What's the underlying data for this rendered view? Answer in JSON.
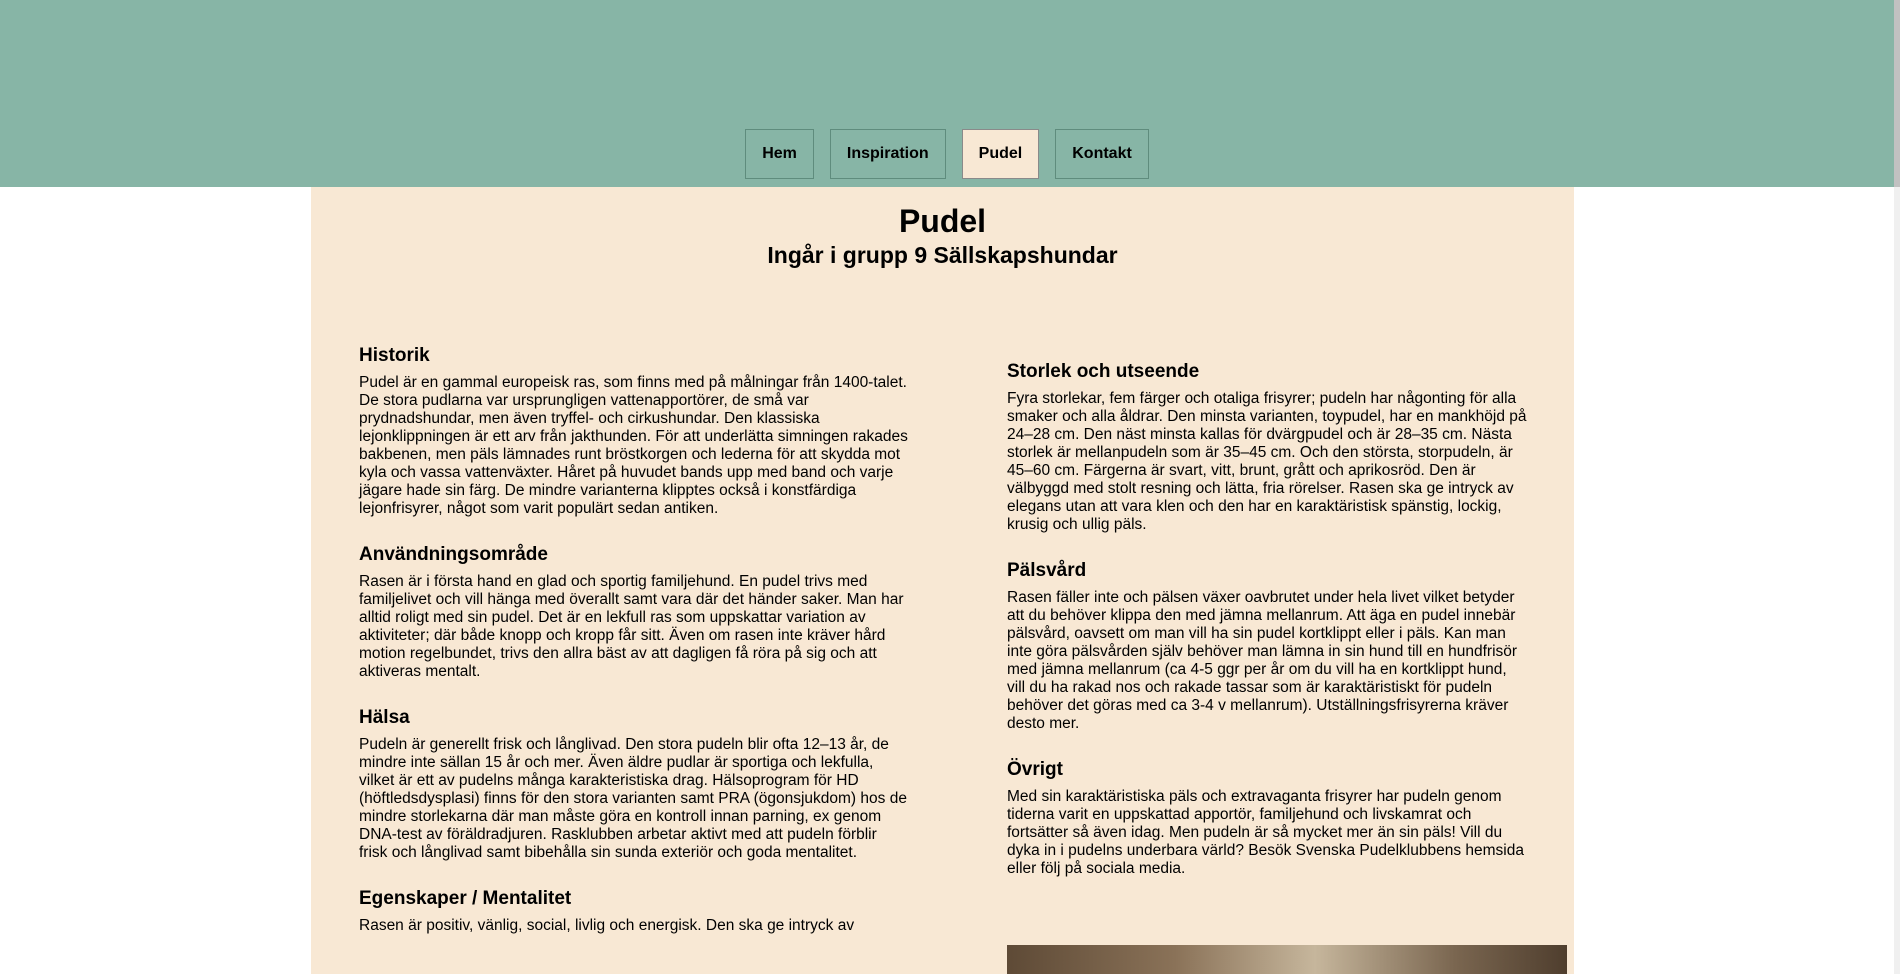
{
  "nav": {
    "items": [
      {
        "label": "Hem",
        "active": false
      },
      {
        "label": "Inspiration",
        "active": false
      },
      {
        "label": "Pudel",
        "active": true
      },
      {
        "label": "Kontakt",
        "active": false
      }
    ]
  },
  "page": {
    "title": "Pudel",
    "subtitle": "Ingår i grupp 9 Sällskapshundar"
  },
  "left_sections": [
    {
      "heading": "Historik",
      "text": "Pudel är en gammal europeisk ras, som finns med på målningar från 1400-talet. De stora pudlarna var ursprungligen vattenapportörer, de små var prydnadshundar, men även tryffel- och cirkushundar. Den klassiska lejonklippningen är ett arv från jakthunden. För att underlätta simningen rakades bakbenen, men päls lämnades runt bröstkorgen och lederna för att skydda mot kyla och vassa vattenväxter. Håret på huvudet bands upp med band och varje jägare hade sin färg. De mindre varianterna klipptes också i konstfärdiga lejonfrisyrer, något som varit populärt sedan antiken."
    },
    {
      "heading": "Användningsområde",
      "text": "Rasen är i första hand en glad och sportig familjehund. En pudel trivs med familjelivet och vill hänga med överallt samt vara där det händer saker. Man har alltid roligt med sin pudel. Det är en lekfull ras som uppskattar variation av aktiviteter; där både knopp och kropp får sitt. Även om rasen inte kräver hård motion regelbundet, trivs den allra bäst av att dagligen få röra på sig och att aktiveras mentalt."
    },
    {
      "heading": "Hälsa",
      "text": "Pudeln är generellt frisk och långlivad. Den stora pudeln blir ofta 12–13 år, de mindre inte sällan 15 år och mer. Även äldre pudlar är sportiga och lekfulla, vilket är ett av pudelns många karakteristiska drag. Hälsoprogram för HD (höftledsdysplasi) finns för den stora varianten samt PRA (ögonsjukdom) hos de mindre storlekarna där man måste göra en kontroll innan parning, ex genom DNA-test av föräldradjuren. Rasklubben arbetar aktivt med att pudeln förblir frisk och långlivad samt bibehålla sin sunda exteriör och goda mentalitet."
    },
    {
      "heading": "Egenskaper / Mentalitet",
      "text": "Rasen är positiv, vänlig, social, livlig och energisk. Den ska ge intryck av"
    }
  ],
  "right_sections": [
    {
      "heading": "Storlek och utseende",
      "text": "Fyra storlekar, fem färger och otaliga frisyrer; pudeln har någonting för alla smaker och alla åldrar. Den minsta varianten, toypudel, har en mankhöjd på 24–28 cm. Den näst minsta kallas för dvärgpudel och är 28–35 cm. Nästa storlek är mellanpudeln som är 35–45 cm. Och den största, storpudeln, är 45–60 cm. Färgerna är svart, vitt, brunt, grått och aprikosröd. Den är välbyggd med stolt resning och lätta, fria rörelser. Rasen ska ge intryck av elegans utan att vara klen och den har en karaktäristisk spänstig, lockig, krusig och ullig päls."
    },
    {
      "heading": "Pälsvård",
      "text": "Rasen fäller inte och pälsen växer oavbrutet under hela livet vilket betyder att du behöver klippa den med jämna mellanrum. Att äga en pudel innebär pälsvård, oavsett om man vill ha sin pudel kortklippt eller i päls. Kan man inte göra pälsvården själv behöver man lämna in sin hund till en hundfrisör med jämna mellanrum (ca 4-5 ggr per år om du vill ha en kortklippt hund, vill du ha rakad nos och rakade tassar som är karaktäristiskt för pudeln behöver det göras med ca 3-4 v mellanrum). Utställningsfrisyrerna kräver desto mer."
    },
    {
      "heading": "Övrigt",
      "text": "Med sin karaktäristiska päls och extravaganta frisyrer har pudeln genom tiderna varit en uppskattad apportör, familjehund och livskamrat och fortsätter så även idag. Men pudeln är så mycket mer än sin päls! Vill du dyka in i pudelns underbara värld? Besök Svenska Pudelklubbens hemsida eller följ på sociala media."
    }
  ],
  "colors": {
    "header_bg": "#87b5a6",
    "content_bg": "#f8e8d4",
    "active_tab_bg": "#f8e8d4"
  },
  "icons": {
    "photo": "poodle-photo"
  }
}
